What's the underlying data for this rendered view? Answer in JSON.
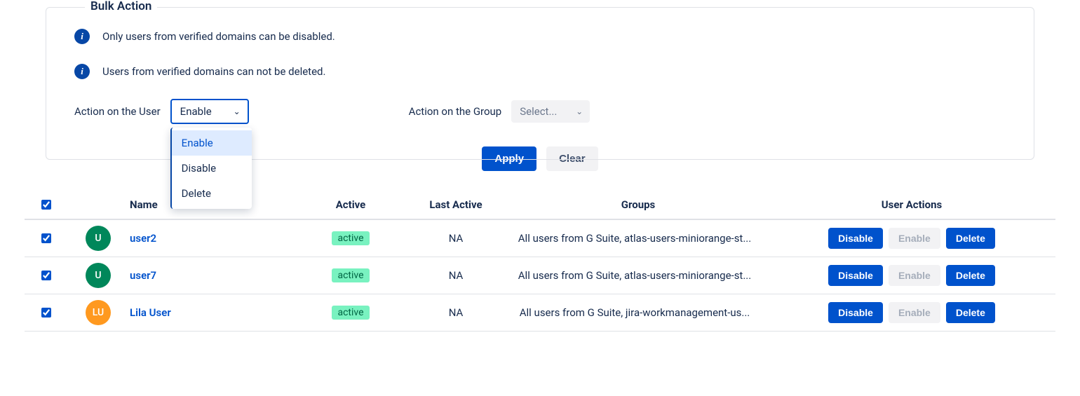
{
  "bulk_action": {
    "legend": "Bulk Action",
    "info1": "Only users from verified domains can be disabled.",
    "info2": "Users from verified domains can not be deleted.",
    "user_action_label": "Action on the User",
    "group_action_label": "Action on the Group",
    "user_select_value": "Enable",
    "group_select_value": "Select...",
    "dropdown": [
      "Enable",
      "Disable",
      "Delete"
    ],
    "apply_label": "Apply",
    "clear_label": "Clear"
  },
  "table": {
    "headers": {
      "name": "Name",
      "active": "Active",
      "last_active": "Last Active",
      "groups": "Groups",
      "user_actions": "User Actions"
    },
    "rows": [
      {
        "checked": true,
        "avatar_text": "U",
        "avatar_color": "green",
        "name": "user2",
        "active": "active",
        "last_active": "NA",
        "groups": "All users from G Suite, atlas-users-miniorange-st..."
      },
      {
        "checked": true,
        "avatar_text": "U",
        "avatar_color": "green",
        "name": "user7",
        "active": "active",
        "last_active": "NA",
        "groups": "All users from G Suite, atlas-users-miniorange-st..."
      },
      {
        "checked": true,
        "avatar_text": "LU",
        "avatar_color": "orange",
        "name": "Lila User",
        "active": "active",
        "last_active": "NA",
        "groups": "All users from G Suite, jira-workmanagement-us..."
      }
    ],
    "row_buttons": {
      "disable": "Disable",
      "enable": "Enable",
      "delete": "Delete"
    }
  }
}
